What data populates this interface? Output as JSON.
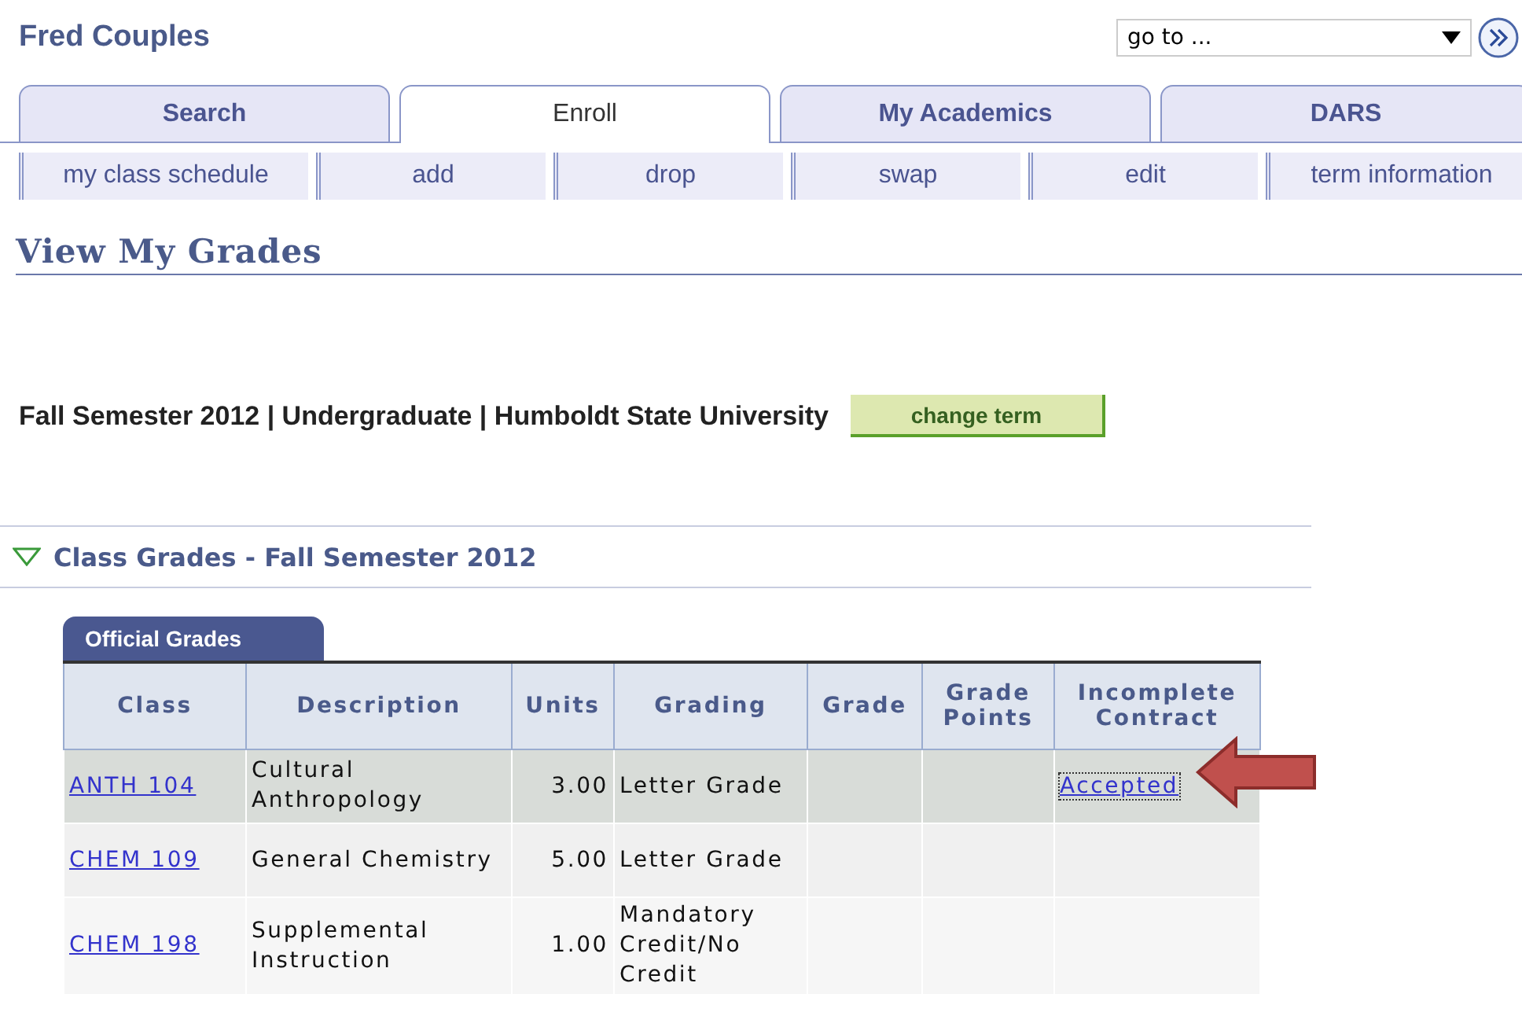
{
  "user_name": "Fred Couples",
  "goto": {
    "value": "go to ..."
  },
  "tabs": [
    {
      "label": "Search",
      "selected": false
    },
    {
      "label": "Enroll",
      "selected": true
    },
    {
      "label": "My Academics",
      "selected": false
    },
    {
      "label": "DARS",
      "selected": false
    }
  ],
  "subnav": [
    "my class schedule",
    "add",
    "drop",
    "swap",
    "edit",
    "term information"
  ],
  "page_title": "View My Grades",
  "term": {
    "text": "Fall Semester 2012 | Undergraduate | Humboldt State University",
    "button": "change term"
  },
  "section": {
    "title": "Class Grades - Fall Semester 2012",
    "expanded": true
  },
  "grid_tab": "Official Grades",
  "table": {
    "columns": [
      "Class",
      "Description",
      "Units",
      "Grading",
      "Grade",
      "Grade Points",
      "Incomplete Contract"
    ],
    "rows": [
      {
        "class": "ANTH 104",
        "description": "Cultural Anthropology",
        "units": "3.00",
        "grading": "Letter Grade",
        "incomplete_contract": "Accepted",
        "selected": true
      },
      {
        "class": "CHEM 109",
        "description": "General Chemistry",
        "units": "5.00",
        "grading": "Letter Grade",
        "selected": false
      },
      {
        "class": "CHEM 198",
        "description": "Supplemental Instruction",
        "units": "1.00",
        "grading": "Mandatory Credit/No Credit",
        "selected": false
      }
    ]
  }
}
